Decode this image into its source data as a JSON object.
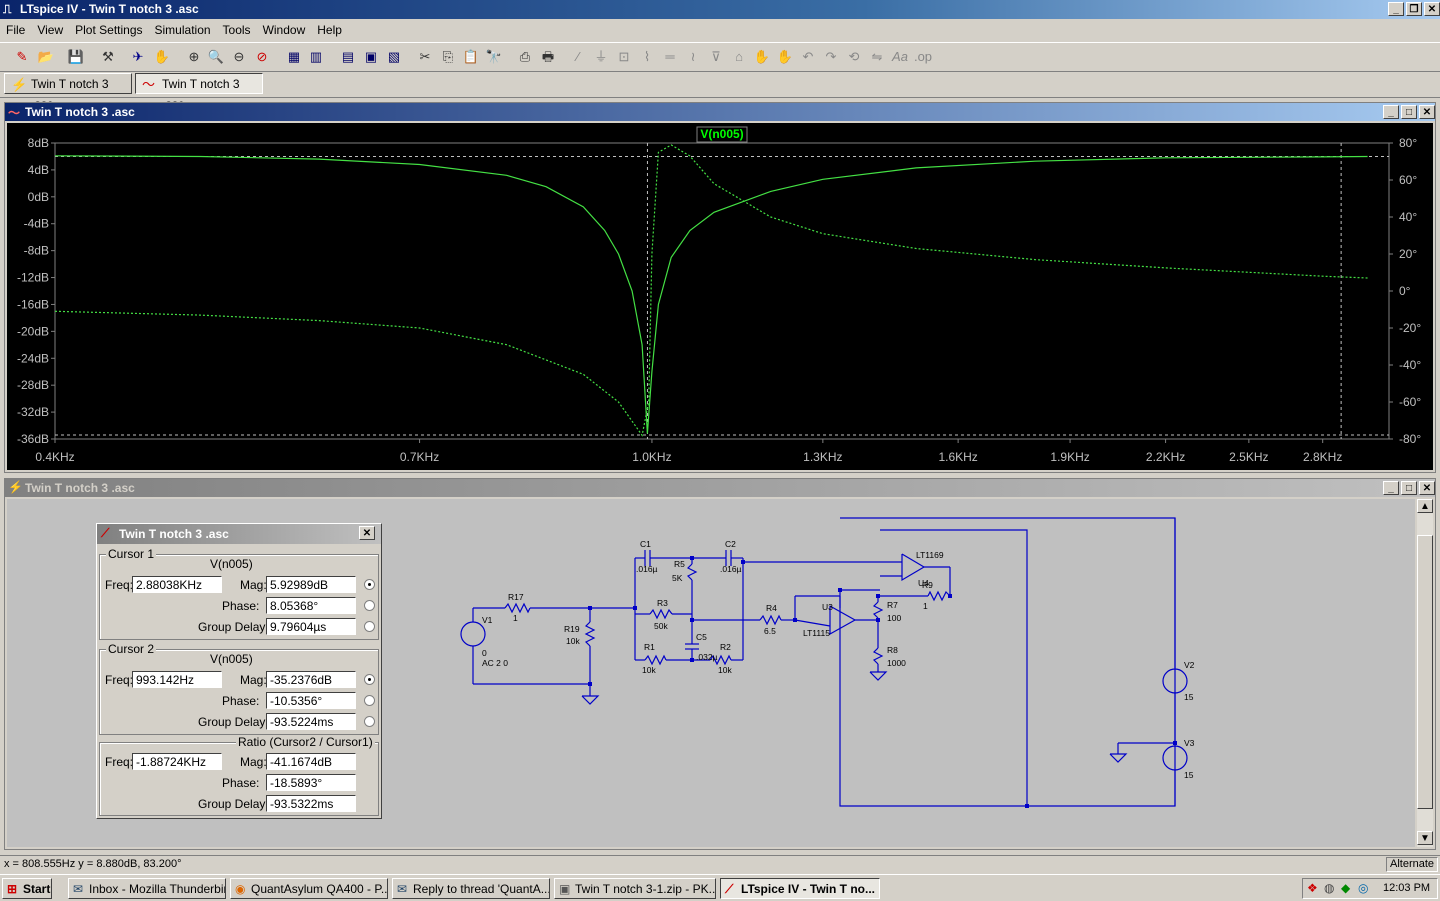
{
  "app": {
    "title": "LTspice IV - Twin T notch 3 .asc"
  },
  "menu": [
    "File",
    "View",
    "Plot Settings",
    "Simulation",
    "Tools",
    "Window",
    "Help"
  ],
  "tabs": [
    {
      "label": "Twin T notch 3 .asc",
      "icon": "schematic-icon"
    },
    {
      "label": "Twin T notch 3 .asc",
      "icon": "waveform-icon"
    }
  ],
  "plot_window": {
    "title": "Twin T notch 3 .asc",
    "trace_label": "V(n005)"
  },
  "schematic_window": {
    "title": "Twin T notch 3 .asc"
  },
  "chart_data": {
    "type": "line",
    "x_scale": "log",
    "x_ticks": [
      "0.4KHz",
      "0.7KHz",
      "1.0KHz",
      "1.3KHz",
      "1.6KHz",
      "1.9KHz",
      "2.2KHz",
      "2.5KHz",
      "2.8KHz"
    ],
    "x_tick_values": [
      400,
      700,
      1000,
      1300,
      1600,
      1900,
      2200,
      2500,
      2800
    ],
    "y_left_ticks": [
      "8dB",
      "4dB",
      "0dB",
      "-4dB",
      "-8dB",
      "-12dB",
      "-16dB",
      "-20dB",
      "-24dB",
      "-28dB",
      "-32dB",
      "-36dB"
    ],
    "y_right_ticks": [
      "80°",
      "60°",
      "40°",
      "20°",
      "0°",
      "-20°",
      "-40°",
      "-60°",
      "-80°"
    ],
    "ylim_left": [
      -36,
      8
    ],
    "ylim_right": [
      -80,
      80
    ],
    "xlim": [
      400,
      3100
    ],
    "series": [
      {
        "name": "V(n005)",
        "style": "solid",
        "axis": "left",
        "unit": "dB",
        "x": [
          400,
          500,
          600,
          700,
          800,
          850,
          900,
          930,
          950,
          970,
          985,
          993,
          1000,
          1010,
          1030,
          1060,
          1100,
          1200,
          1300,
          1500,
          1800,
          2200,
          2800,
          3000
        ],
        "y": [
          6.1,
          6.0,
          5.6,
          4.8,
          3.2,
          1.5,
          -1.5,
          -5,
          -8.5,
          -14,
          -22,
          -35.2,
          -26,
          -16,
          -9,
          -5,
          -2.3,
          0.8,
          2.6,
          4.3,
          5.3,
          5.8,
          5.93,
          6.0
        ]
      },
      {
        "name": "V(n005) phase",
        "style": "dashed",
        "axis": "right",
        "unit": "°",
        "x": [
          400,
          500,
          600,
          700,
          800,
          900,
          950,
          985,
          995,
          1000,
          1010,
          1030,
          1060,
          1100,
          1200,
          1300,
          1500,
          1800,
          2200,
          2800,
          3000
        ],
        "y": [
          -11,
          -13,
          -16,
          -20,
          -29,
          -45,
          -60,
          -78,
          -60,
          20,
          75,
          79,
          73,
          58,
          40,
          31,
          23,
          17,
          12.5,
          8,
          7
        ]
      }
    ],
    "cursors": [
      993.142,
      2880.38
    ],
    "grid": false
  },
  "cursor_panel": {
    "title": "Twin T notch 3 .asc",
    "cursor1": {
      "label": "Cursor 1",
      "trace": "V(n005)",
      "freq_label": "Freq:",
      "freq": "2.88038KHz",
      "mag_label": "Mag:",
      "mag": "5.92989dB",
      "phase_label": "Phase:",
      "phase": "8.05368°",
      "gd_label": "Group Delay:",
      "gd": "9.79604µs"
    },
    "cursor2": {
      "label": "Cursor 2",
      "trace": "V(n005)",
      "freq_label": "Freq:",
      "freq": "993.142Hz",
      "mag_label": "Mag:",
      "mag": "-35.2376dB",
      "phase_label": "Phase:",
      "phase": "-10.5356°",
      "gd_label": "Group Delay:",
      "gd": "-93.5224ms"
    },
    "ratio": {
      "label": "Ratio (Cursor2 / Cursor1)",
      "freq_label": "Freq:",
      "freq": "-1.88724KHz",
      "mag_label": "Mag:",
      "mag": "-41.1674dB",
      "phase_label": "Phase:",
      "phase": "-18.5893°",
      "gd_label": "Group Delay:",
      "gd": "-93.5322ms"
    }
  },
  "schematic": {
    "parts": [
      "V1",
      "0",
      "AC 2 0",
      "R17",
      "1",
      "R19",
      "10k",
      "C1",
      ".016µ",
      "R5",
      "5K",
      "C2",
      ".016µ",
      "R3",
      "50k",
      "C5",
      ".032µ",
      "R1",
      "10k",
      "R2",
      "10k",
      "R4",
      "6.5",
      "U3",
      "LT1115",
      "LT1169",
      "U4",
      "R9",
      "1",
      "R7",
      "100",
      "R8",
      "1000",
      "V2",
      "15",
      "V3",
      "15"
    ]
  },
  "status": {
    "coords": "x = 808.555Hz    y = 8.880dB, 83.200°",
    "mode": "Alternate"
  },
  "taskbar": {
    "start": "Start",
    "tasks": [
      "Inbox - Mozilla Thunderbird",
      "QuantAsylum QA400 - P...",
      "Reply to thread 'QuantA...",
      "Twin T notch 3-1.zip - PK...",
      "LTspice IV - Twin T no..."
    ],
    "clock": "12:03 PM"
  }
}
